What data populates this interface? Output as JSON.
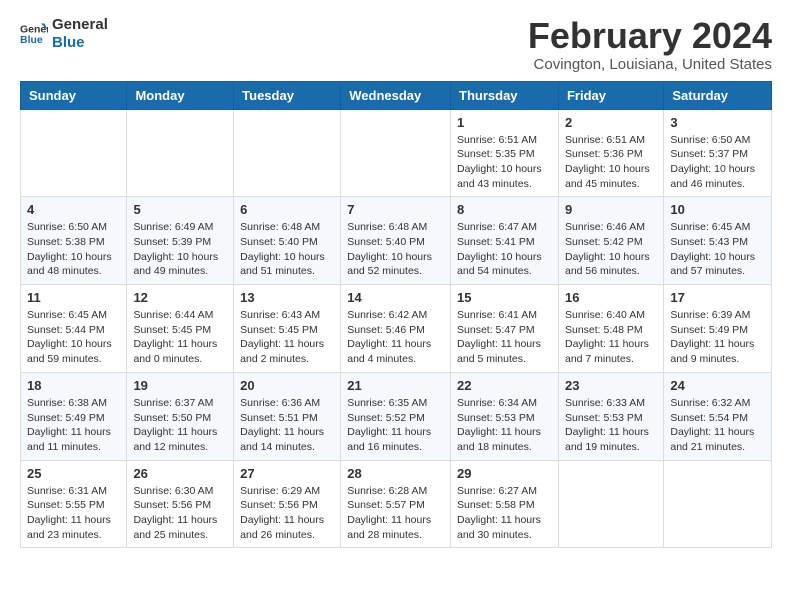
{
  "logo": {
    "line1": "General",
    "line2": "Blue"
  },
  "title": "February 2024",
  "location": "Covington, Louisiana, United States",
  "weekdays": [
    "Sunday",
    "Monday",
    "Tuesday",
    "Wednesday",
    "Thursday",
    "Friday",
    "Saturday"
  ],
  "weeks": [
    [
      {
        "day": "",
        "info": ""
      },
      {
        "day": "",
        "info": ""
      },
      {
        "day": "",
        "info": ""
      },
      {
        "day": "",
        "info": ""
      },
      {
        "day": "1",
        "info": "Sunrise: 6:51 AM\nSunset: 5:35 PM\nDaylight: 10 hours\nand 43 minutes."
      },
      {
        "day": "2",
        "info": "Sunrise: 6:51 AM\nSunset: 5:36 PM\nDaylight: 10 hours\nand 45 minutes."
      },
      {
        "day": "3",
        "info": "Sunrise: 6:50 AM\nSunset: 5:37 PM\nDaylight: 10 hours\nand 46 minutes."
      }
    ],
    [
      {
        "day": "4",
        "info": "Sunrise: 6:50 AM\nSunset: 5:38 PM\nDaylight: 10 hours\nand 48 minutes."
      },
      {
        "day": "5",
        "info": "Sunrise: 6:49 AM\nSunset: 5:39 PM\nDaylight: 10 hours\nand 49 minutes."
      },
      {
        "day": "6",
        "info": "Sunrise: 6:48 AM\nSunset: 5:40 PM\nDaylight: 10 hours\nand 51 minutes."
      },
      {
        "day": "7",
        "info": "Sunrise: 6:48 AM\nSunset: 5:40 PM\nDaylight: 10 hours\nand 52 minutes."
      },
      {
        "day": "8",
        "info": "Sunrise: 6:47 AM\nSunset: 5:41 PM\nDaylight: 10 hours\nand 54 minutes."
      },
      {
        "day": "9",
        "info": "Sunrise: 6:46 AM\nSunset: 5:42 PM\nDaylight: 10 hours\nand 56 minutes."
      },
      {
        "day": "10",
        "info": "Sunrise: 6:45 AM\nSunset: 5:43 PM\nDaylight: 10 hours\nand 57 minutes."
      }
    ],
    [
      {
        "day": "11",
        "info": "Sunrise: 6:45 AM\nSunset: 5:44 PM\nDaylight: 10 hours\nand 59 minutes."
      },
      {
        "day": "12",
        "info": "Sunrise: 6:44 AM\nSunset: 5:45 PM\nDaylight: 11 hours\nand 0 minutes."
      },
      {
        "day": "13",
        "info": "Sunrise: 6:43 AM\nSunset: 5:45 PM\nDaylight: 11 hours\nand 2 minutes."
      },
      {
        "day": "14",
        "info": "Sunrise: 6:42 AM\nSunset: 5:46 PM\nDaylight: 11 hours\nand 4 minutes."
      },
      {
        "day": "15",
        "info": "Sunrise: 6:41 AM\nSunset: 5:47 PM\nDaylight: 11 hours\nand 5 minutes."
      },
      {
        "day": "16",
        "info": "Sunrise: 6:40 AM\nSunset: 5:48 PM\nDaylight: 11 hours\nand 7 minutes."
      },
      {
        "day": "17",
        "info": "Sunrise: 6:39 AM\nSunset: 5:49 PM\nDaylight: 11 hours\nand 9 minutes."
      }
    ],
    [
      {
        "day": "18",
        "info": "Sunrise: 6:38 AM\nSunset: 5:49 PM\nDaylight: 11 hours\nand 11 minutes."
      },
      {
        "day": "19",
        "info": "Sunrise: 6:37 AM\nSunset: 5:50 PM\nDaylight: 11 hours\nand 12 minutes."
      },
      {
        "day": "20",
        "info": "Sunrise: 6:36 AM\nSunset: 5:51 PM\nDaylight: 11 hours\nand 14 minutes."
      },
      {
        "day": "21",
        "info": "Sunrise: 6:35 AM\nSunset: 5:52 PM\nDaylight: 11 hours\nand 16 minutes."
      },
      {
        "day": "22",
        "info": "Sunrise: 6:34 AM\nSunset: 5:53 PM\nDaylight: 11 hours\nand 18 minutes."
      },
      {
        "day": "23",
        "info": "Sunrise: 6:33 AM\nSunset: 5:53 PM\nDaylight: 11 hours\nand 19 minutes."
      },
      {
        "day": "24",
        "info": "Sunrise: 6:32 AM\nSunset: 5:54 PM\nDaylight: 11 hours\nand 21 minutes."
      }
    ],
    [
      {
        "day": "25",
        "info": "Sunrise: 6:31 AM\nSunset: 5:55 PM\nDaylight: 11 hours\nand 23 minutes."
      },
      {
        "day": "26",
        "info": "Sunrise: 6:30 AM\nSunset: 5:56 PM\nDaylight: 11 hours\nand 25 minutes."
      },
      {
        "day": "27",
        "info": "Sunrise: 6:29 AM\nSunset: 5:56 PM\nDaylight: 11 hours\nand 26 minutes."
      },
      {
        "day": "28",
        "info": "Sunrise: 6:28 AM\nSunset: 5:57 PM\nDaylight: 11 hours\nand 28 minutes."
      },
      {
        "day": "29",
        "info": "Sunrise: 6:27 AM\nSunset: 5:58 PM\nDaylight: 11 hours\nand 30 minutes."
      },
      {
        "day": "",
        "info": ""
      },
      {
        "day": "",
        "info": ""
      }
    ]
  ]
}
